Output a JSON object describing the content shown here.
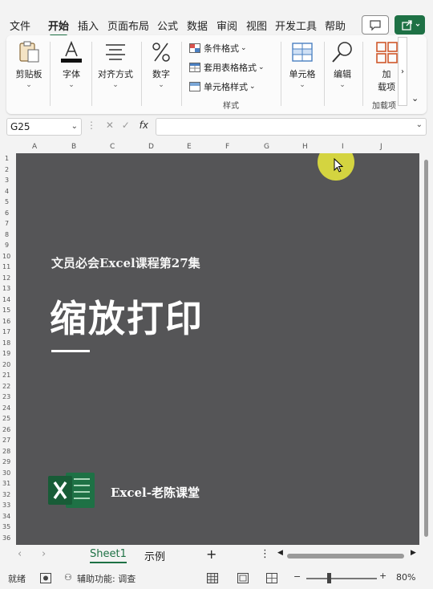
{
  "menu": {
    "tabs": [
      "文件",
      "开始",
      "插入",
      "页面布局",
      "公式",
      "数据",
      "审阅",
      "视图",
      "开发工具",
      "帮助"
    ],
    "active_tab": "开始"
  },
  "ribbon": {
    "clipboard": "剪贴板",
    "font": "字体",
    "alignment": "对齐方式",
    "number": "数字",
    "conditional_format": "条件格式",
    "table_format": "套用表格格式",
    "cell_style": "单元格样式",
    "styles_group": "样式",
    "cells": "单元格",
    "editing": "编辑",
    "addins_line1": "加",
    "addins_line2": "载项",
    "addins_group": "加载项"
  },
  "formula_bar": {
    "name_box": "G25",
    "fx": "fx",
    "value": ""
  },
  "grid": {
    "columns": [
      "A",
      "B",
      "C",
      "D",
      "E",
      "F",
      "G",
      "H",
      "I",
      "J"
    ],
    "rows": [
      "1",
      "2",
      "3",
      "4",
      "5",
      "6",
      "7",
      "8",
      "9",
      "10",
      "11",
      "12",
      "13",
      "14",
      "15",
      "16",
      "17",
      "18",
      "19",
      "20",
      "21",
      "22",
      "23",
      "24",
      "25",
      "26",
      "27",
      "28",
      "29",
      "30",
      "31",
      "32",
      "33",
      "34",
      "35",
      "36"
    ]
  },
  "slide": {
    "subtitle": "文员必会Excel课程第27集",
    "title": "缩放打印",
    "brand": "Excel-老陈课堂"
  },
  "sheets": {
    "tabs": [
      "Sheet1",
      "示例"
    ],
    "active": "Sheet1",
    "add": "+"
  },
  "status": {
    "ready": "就绪",
    "accessibility": "辅助功能: 调查",
    "zoom_minus": "−",
    "zoom_plus": "+",
    "zoom": "80%"
  },
  "colors": {
    "accent": "#1e7145",
    "slide_bg": "#555557",
    "cursor_highlight": "#ebeb3c"
  }
}
